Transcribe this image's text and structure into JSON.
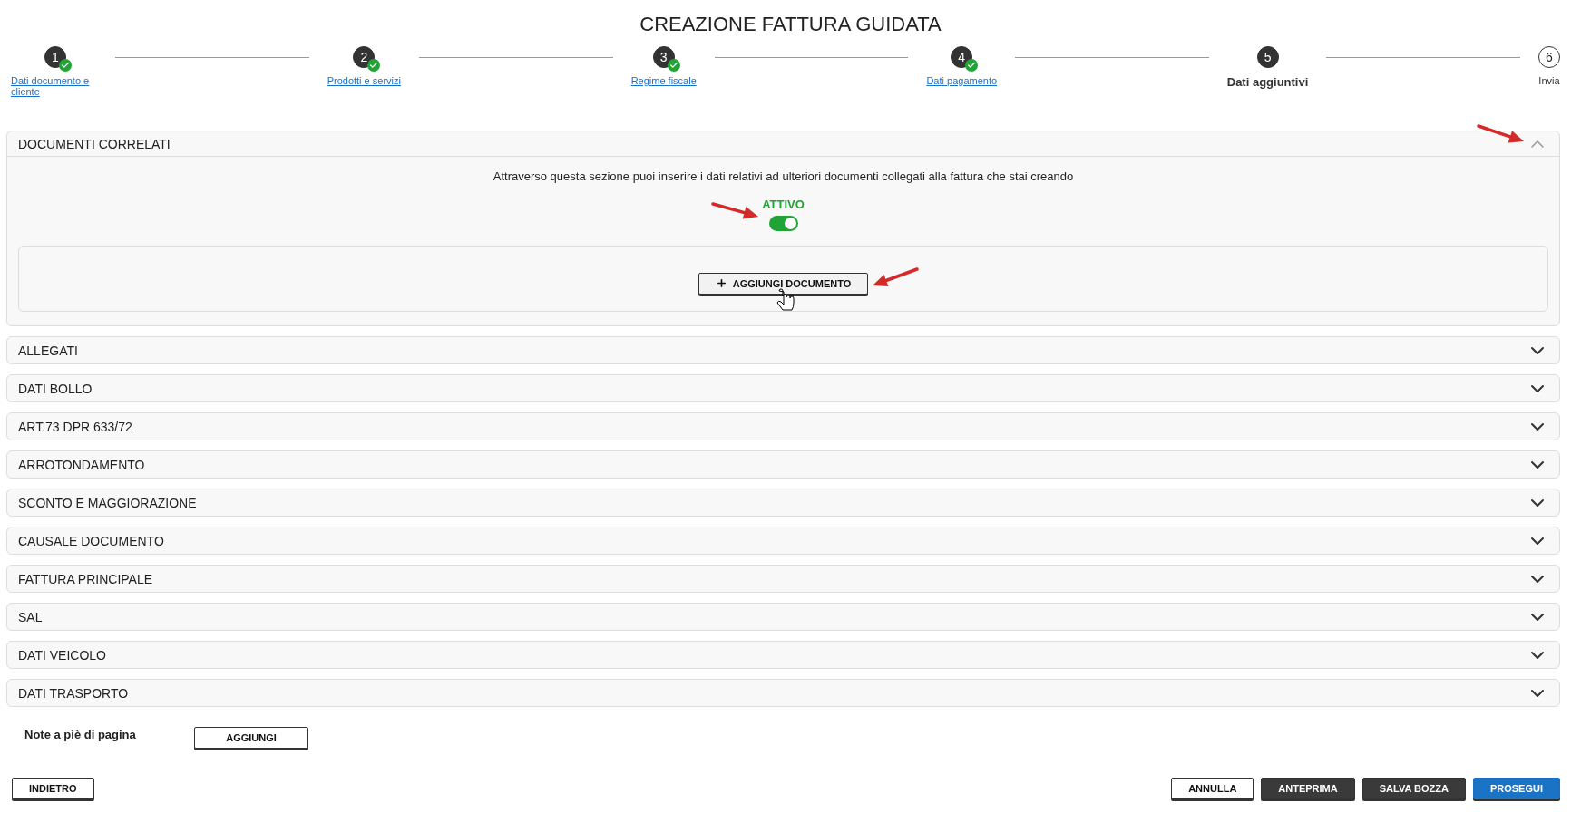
{
  "title": "CREAZIONE FATTURA GUIDATA",
  "steps": [
    {
      "number": "1",
      "label": "Dati documento e cliente",
      "completed": true,
      "selected": false
    },
    {
      "number": "2",
      "label": "Prodotti e servizi",
      "completed": true,
      "selected": false
    },
    {
      "number": "3",
      "label": "Regime fiscale",
      "completed": true,
      "selected": false
    },
    {
      "number": "4",
      "label": "Dati pagamento",
      "completed": true,
      "selected": false
    },
    {
      "number": "5",
      "label": "Dati aggiuntivi",
      "completed": false,
      "selected": true
    },
    {
      "number": "6",
      "label": "Invia",
      "completed": false,
      "selected": false
    }
  ],
  "sections": [
    {
      "title": "DOCUMENTI CORRELATI",
      "expanded": true,
      "description": "Attraverso questa sezione puoi inserire i dati relativi ad ulteriori documenti collegati alla fattura che stai creando",
      "toggle": {
        "label": "ATTIVO",
        "on": true
      },
      "add_button": "AGGIUNGI DOCUMENTO"
    },
    {
      "title": "ALLEGATI",
      "expanded": false
    },
    {
      "title": "DATI BOLLO",
      "expanded": false
    },
    {
      "title": "ART.73 DPR 633/72",
      "expanded": false
    },
    {
      "title": "ARROTONDAMENTO",
      "expanded": false
    },
    {
      "title": "SCONTO E MAGGIORAZIONE",
      "expanded": false
    },
    {
      "title": "CAUSALE DOCUMENTO",
      "expanded": false
    },
    {
      "title": "FATTURA PRINCIPALE",
      "expanded": false
    },
    {
      "title": "SAL",
      "expanded": false
    },
    {
      "title": "DATI VEICOLO",
      "expanded": false
    },
    {
      "title": "DATI TRASPORTO",
      "expanded": false
    }
  ],
  "footer_notes": {
    "label": "Note a piè di pagina",
    "button": "AGGIUNGI"
  },
  "actions_left": [
    {
      "label": "INDIETRO",
      "kind": "outline"
    }
  ],
  "actions_right": [
    {
      "label": "ANNULLA",
      "kind": "outline"
    },
    {
      "label": "ANTEPRIMA",
      "kind": "dark"
    },
    {
      "label": "SALVA BOZZA",
      "kind": "dark"
    },
    {
      "label": "PROSEGUI",
      "kind": "primary"
    }
  ]
}
